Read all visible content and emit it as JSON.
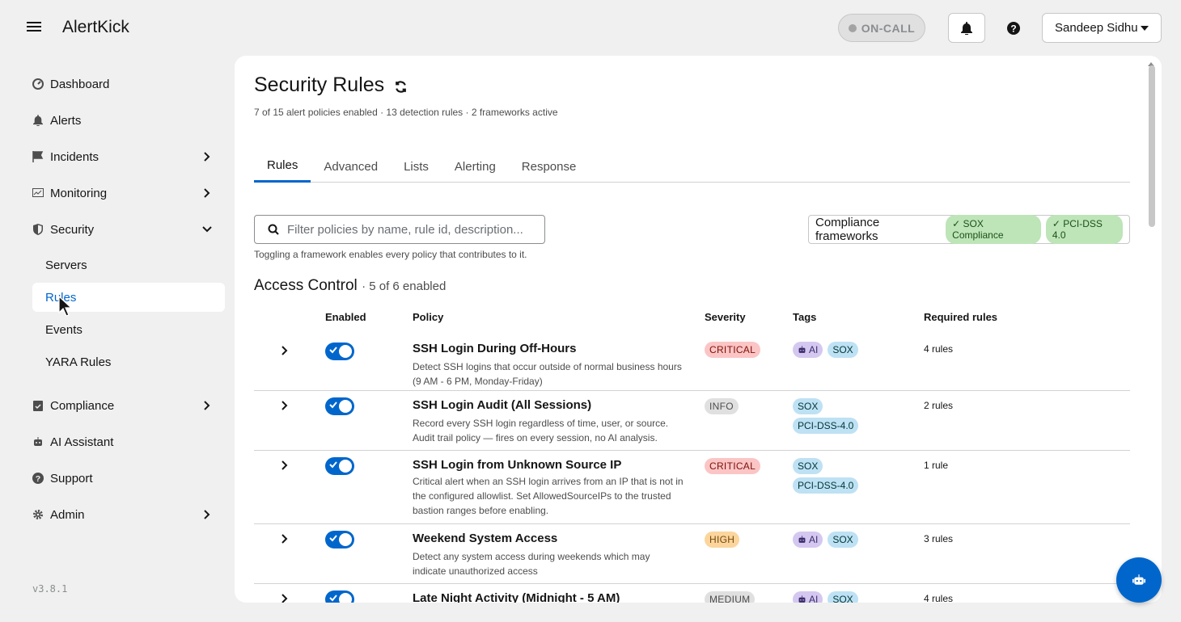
{
  "app": {
    "brand": "AlertKick",
    "version": "v3.8.1"
  },
  "header": {
    "oncall_label": "ON-CALL",
    "user_name": "Sandeep Sidhu"
  },
  "sidebar": {
    "items": [
      {
        "label": "Dashboard",
        "icon": "dashboard-icon"
      },
      {
        "label": "Alerts",
        "icon": "bell-icon"
      },
      {
        "label": "Incidents",
        "icon": "flag-icon"
      },
      {
        "label": "Monitoring",
        "icon": "monitor-chart-icon"
      },
      {
        "label": "Security",
        "icon": "shield-icon"
      },
      {
        "label": "Compliance",
        "icon": "clipboard-check-icon"
      },
      {
        "label": "AI Assistant",
        "icon": "robot-icon"
      },
      {
        "label": "Support",
        "icon": "question-circle-icon"
      },
      {
        "label": "Admin",
        "icon": "gear-icon"
      }
    ],
    "security_sub": [
      "Servers",
      "Rules",
      "Events",
      "YARA Rules"
    ],
    "active_sub": "Rules"
  },
  "page": {
    "title": "Security Rules",
    "subtitle": "7 of 15 alert policies enabled · 13 detection rules · 2 frameworks active",
    "tabs": [
      "Rules",
      "Advanced",
      "Lists",
      "Alerting",
      "Response"
    ],
    "search_placeholder": "Filter policies by name, rule id, description...",
    "hint": "Toggling a framework enables every policy that contributes to it.",
    "frameworks_label": "Compliance frameworks",
    "frameworks": [
      "✓ SOX Compliance",
      "✓ PCI-DSS 4.0"
    ]
  },
  "section": {
    "title": "Access Control",
    "count": "· 5 of 6 enabled"
  },
  "table": {
    "headers": {
      "enabled": "Enabled",
      "policy": "Policy",
      "severity": "Severity",
      "tags": "Tags",
      "required": "Required rules"
    },
    "rows": [
      {
        "name": "SSH Login During Off-Hours",
        "desc": "Detect SSH logins that occur outside of normal business hours (9 AM - 6 PM, Monday-Friday)",
        "severity": "CRITICAL",
        "tags": [
          "AI",
          "SOX"
        ],
        "required": "4 rules",
        "enabled": true
      },
      {
        "name": "SSH Login Audit (All Sessions)",
        "desc": "Record every SSH login regardless of time, user, or source. Audit trail policy — fires on every session, no AI analysis.",
        "severity": "INFO",
        "tags": [
          "SOX",
          "PCI-DSS-4.0"
        ],
        "required": "2 rules",
        "enabled": true
      },
      {
        "name": "SSH Login from Unknown Source IP",
        "desc": "Critical alert when an SSH login arrives from an IP that is not in the configured allowlist. Set AllowedSourceIPs to the trusted bastion ranges before enabling.",
        "severity": "CRITICAL",
        "tags": [
          "SOX",
          "PCI-DSS-4.0"
        ],
        "required": "1 rule",
        "enabled": true
      },
      {
        "name": "Weekend System Access",
        "desc": "Detect any system access during weekends which may indicate unauthorized access",
        "severity": "HIGH",
        "tags": [
          "AI",
          "SOX"
        ],
        "required": "3 rules",
        "enabled": true
      },
      {
        "name": "Late Night Activity (Midnight - 5 AM)",
        "desc": "",
        "severity": "MEDIUM",
        "tags": [
          "AI",
          "SOX"
        ],
        "required": "4 rules",
        "enabled": true
      }
    ]
  },
  "colors": {
    "accent": "#0066cc",
    "critical_bg": "#fbc5c5",
    "high_bg": "#fbd59c",
    "ai_tag_bg": "#d4c8f0",
    "fw_tag_bg": "#bee1f4",
    "framework_chip_bg": "#bde5b8"
  }
}
